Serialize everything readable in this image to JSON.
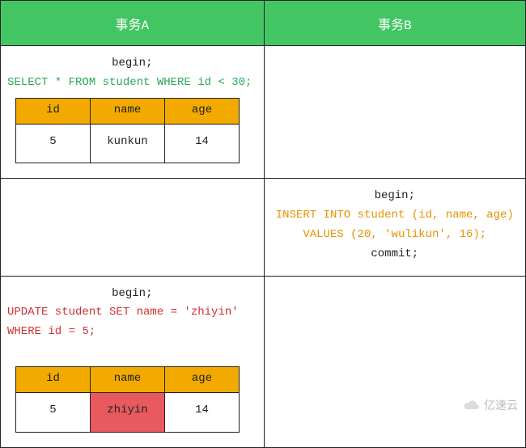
{
  "header": {
    "col_a": "事务A",
    "col_b": "事务B"
  },
  "rows": [
    {
      "a": {
        "lines": [
          {
            "text": "begin;",
            "cls": "sql-black stmt"
          },
          {
            "text": "SELECT * FROM student WHERE id < 30;",
            "cls": "sql-green"
          }
        ],
        "table": {
          "headers": [
            "id",
            "name",
            "age"
          ],
          "rows": [
            {
              "cells": [
                "5",
                "kunkun",
                "14"
              ],
              "hl": []
            }
          ]
        }
      },
      "b": {
        "lines": [],
        "table": null
      }
    },
    {
      "a": {
        "lines": [],
        "table": null
      },
      "b": {
        "lines": [
          {
            "text": "begin;",
            "cls": "sql-black stmt"
          },
          {
            "text": "INSERT INTO student (id, name, age)",
            "cls": "sql-orange-center"
          },
          {
            "text": "VALUES (20, 'wulikun', 16);",
            "cls": "sql-orange-center"
          },
          {
            "text": "commit;",
            "cls": "sql-black stmt"
          }
        ],
        "table": null
      }
    },
    {
      "a": {
        "lines": [
          {
            "text": "begin;",
            "cls": "sql-black stmt"
          },
          {
            "text": "UPDATE student SET name = 'zhiyin' WHERE id = 5;",
            "cls": "sql-red"
          },
          {
            "text": "",
            "cls": "sql-black stmt"
          }
        ],
        "table": {
          "headers": [
            "id",
            "name",
            "age"
          ],
          "rows": [
            {
              "cells": [
                "5",
                "zhiyin",
                "14"
              ],
              "hl": [
                1
              ]
            }
          ]
        }
      },
      "b": {
        "lines": [],
        "table": null
      }
    }
  ],
  "watermark": "亿速云"
}
